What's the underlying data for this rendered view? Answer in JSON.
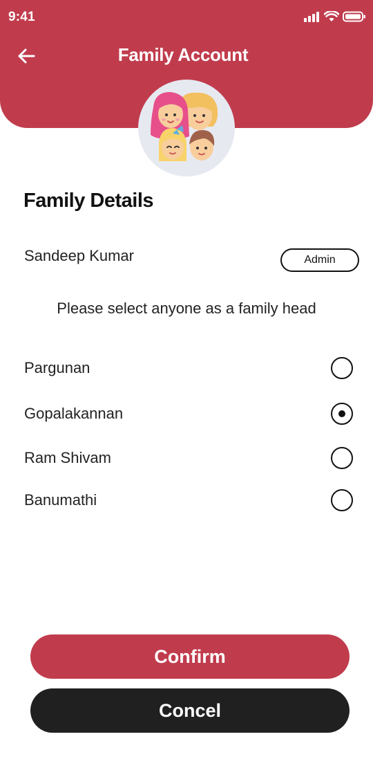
{
  "status_bar": {
    "time": "9:41",
    "icons": [
      "signal-icon",
      "wifi-icon",
      "battery-icon"
    ]
  },
  "header": {
    "title": "Family Account",
    "back_icon": "back-arrow-icon",
    "background_color": "#c03c4d"
  },
  "avatar": {
    "icon": "family-illustration"
  },
  "details": {
    "title": "Family Details",
    "admin_name": "Sandeep Kumar",
    "admin_badge": "Admin",
    "instruction": "Please select anyone as a family head"
  },
  "members": [
    {
      "name": "Pargunan",
      "selected": false
    },
    {
      "name": "Gopalakannan",
      "selected": true
    },
    {
      "name": "Ram Shivam",
      "selected": false
    },
    {
      "name": "Banumathi",
      "selected": false
    }
  ],
  "actions": {
    "confirm_label": "Confirm",
    "cancel_label": "Concel",
    "confirm_color": "#c03c4d",
    "cancel_color": "#202020"
  }
}
